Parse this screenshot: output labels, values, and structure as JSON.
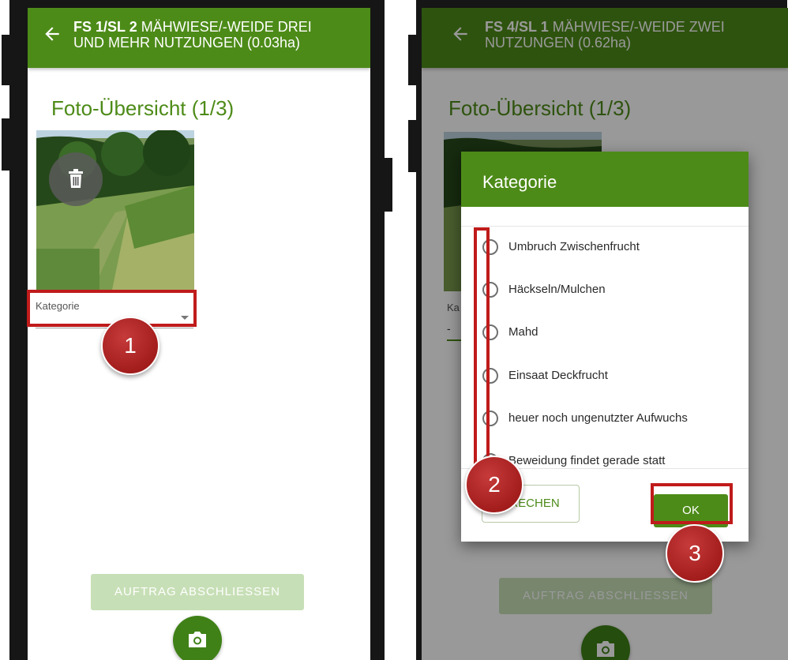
{
  "left_screen": {
    "header": {
      "title_bold": "FS 1/SL 2",
      "title_line1_rest": " MÄHWIESE/-WEIDE DREI",
      "title_line2": "UND MEHR NUTZUNGEN (0.03ha)"
    },
    "page_title": "Foto-Übersicht (1/3)",
    "category_field": {
      "label": "Kategorie"
    },
    "finish_button": "AUFTRAG ABSCHLIESSEN",
    "callout": "1"
  },
  "right_screen": {
    "header": {
      "title_bold": "FS 4/SL 1",
      "title_line1_rest": " MÄHWIESE/-WEIDE ZWEI",
      "title_line2": "NUTZUNGEN (0.62ha)"
    },
    "page_title": "Foto-Übersicht (1/3)",
    "finish_button": "AUFTRAG ABSCHLIESSEN",
    "background_category_fragment": "Ka",
    "background_value_fragment": "-",
    "dialog": {
      "title": "Kategorie",
      "options": [
        "Umbruch Zwischenfrucht",
        "Häckseln/Mulchen",
        "Mahd",
        "Einsaat Deckfrucht",
        "heuer noch ungenutzter Aufwuchs",
        "Beweidung findet gerade statt"
      ],
      "cancel_button": "BRECHEN",
      "ok_button": "OK"
    },
    "callouts": [
      "2",
      "3"
    ]
  },
  "colors": {
    "primary_green": "#4d8b18",
    "annotation_red": "#c01b1b",
    "disabled_button": "#c7dfb6"
  },
  "icons": {
    "back": "arrow-left-icon",
    "delete": "trash-icon",
    "dropdown": "caret-down-icon",
    "camera": "camera-icon"
  }
}
